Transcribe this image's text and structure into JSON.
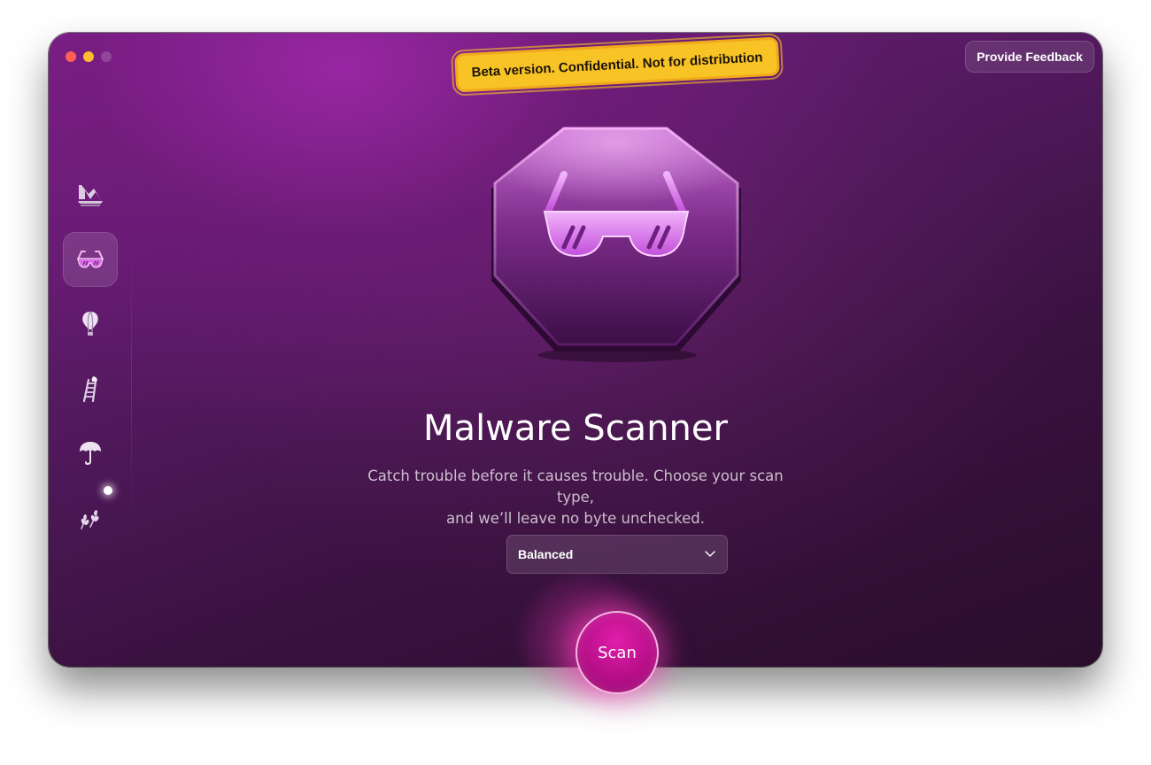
{
  "window": {
    "controls": [
      "close",
      "minimize",
      "maximize"
    ]
  },
  "banner": {
    "text": "Beta version. Confidential. Not for distribution"
  },
  "header": {
    "feedback_label": "Provide Feedback"
  },
  "sidebar": {
    "items": [
      {
        "icon": "cleanup-icon",
        "active": false
      },
      {
        "icon": "sunglasses-icon",
        "active": true
      },
      {
        "icon": "balloon-icon",
        "active": false
      },
      {
        "icon": "ladder-icon",
        "active": false
      },
      {
        "icon": "umbrella-icon",
        "active": false
      },
      {
        "icon": "wheat-icon",
        "active": false,
        "notification": true
      }
    ]
  },
  "main": {
    "hero_icon": "sunglasses-icon",
    "title": "Malware Scanner",
    "subtitle_line1": "Catch trouble before it causes trouble. Choose your scan type,",
    "subtitle_line2": "and we’ll leave no byte unchecked.",
    "scan_type": {
      "selected": "Balanced"
    },
    "scan_label": "Scan"
  },
  "colors": {
    "accent": "#c41595",
    "banner": "#f7c325",
    "background": "#561a62"
  }
}
